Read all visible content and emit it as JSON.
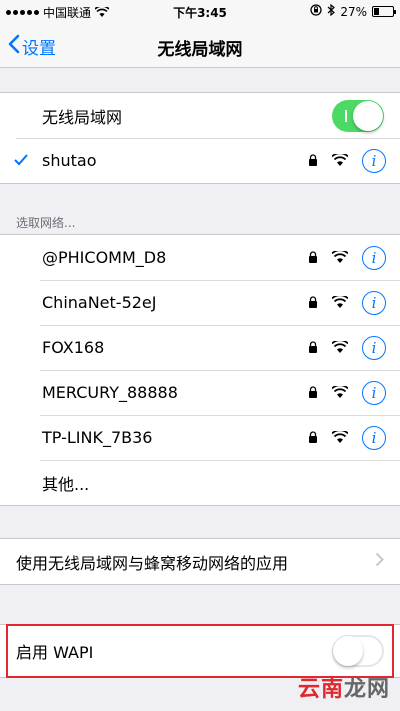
{
  "status_bar": {
    "carrier": "中国联通",
    "time": "下午3:45",
    "battery_percent": "27%",
    "battery_level": 0.27
  },
  "nav": {
    "back_label": "设置",
    "title": "无线局域网"
  },
  "wifi_toggle": {
    "label": "无线局域网",
    "on": true
  },
  "connected": {
    "ssid": "shutao",
    "locked": true
  },
  "networks_header": "选取网络...",
  "networks": [
    {
      "ssid": "@PHICOMM_D8",
      "locked": true
    },
    {
      "ssid": "ChinaNet-52eJ",
      "locked": true
    },
    {
      "ssid": "FOX168",
      "locked": true
    },
    {
      "ssid": "MERCURY_88888",
      "locked": true
    },
    {
      "ssid": "TP-LINK_7B36",
      "locked": true
    }
  ],
  "other_label": "其他...",
  "apps_row_label": "使用无线局域网与蜂窝移动网络的应用",
  "wapi": {
    "label": "启用 WAPI",
    "on": false
  },
  "watermark": {
    "text1": "云南",
    "text2": "龙网"
  },
  "colors": {
    "accent": "#0076ff",
    "toggle_on": "#4cd964",
    "highlight": "#e0282e"
  }
}
